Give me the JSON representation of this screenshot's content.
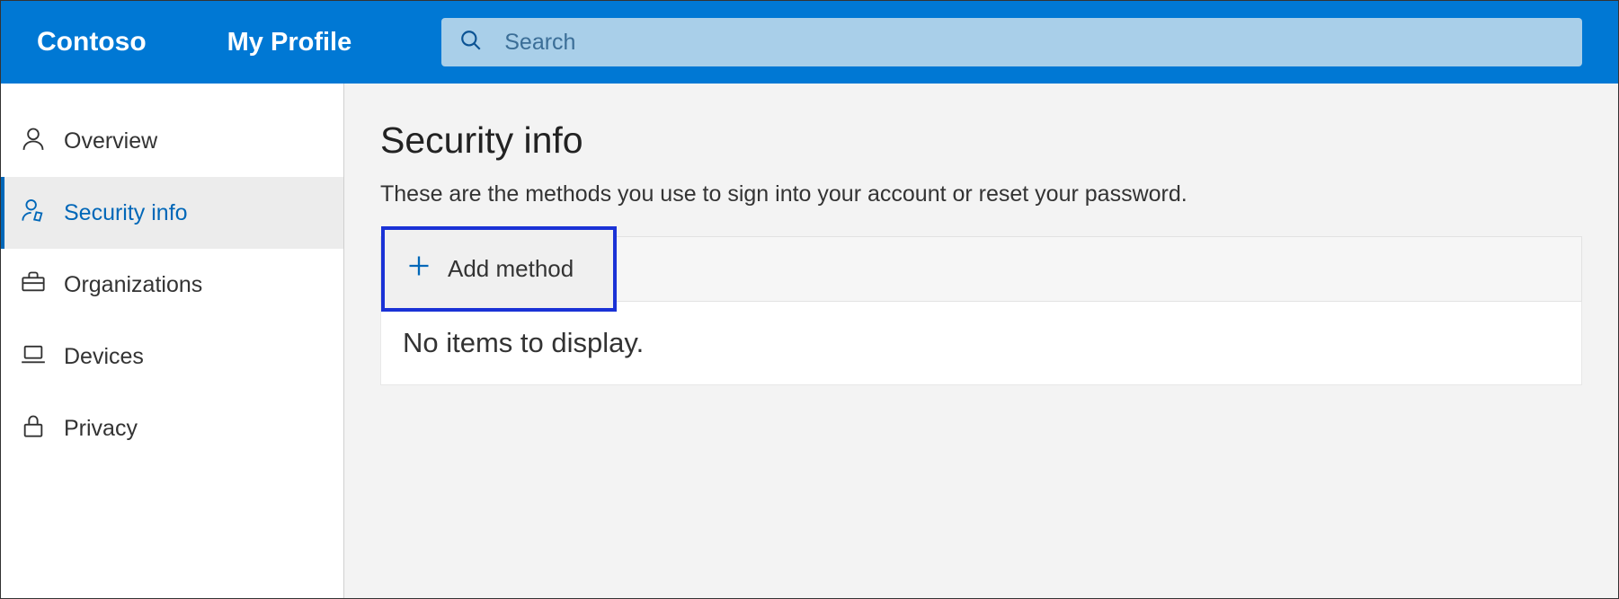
{
  "header": {
    "brand": "Contoso",
    "profile": "My Profile",
    "search_placeholder": "Search"
  },
  "sidebar": {
    "items": [
      {
        "label": "Overview"
      },
      {
        "label": "Security info"
      },
      {
        "label": "Organizations"
      },
      {
        "label": "Devices"
      },
      {
        "label": "Privacy"
      }
    ]
  },
  "main": {
    "title": "Security info",
    "description": "These are the methods you use to sign into your account or reset your password.",
    "add_method_label": "Add method",
    "empty_message": "No items to display."
  }
}
